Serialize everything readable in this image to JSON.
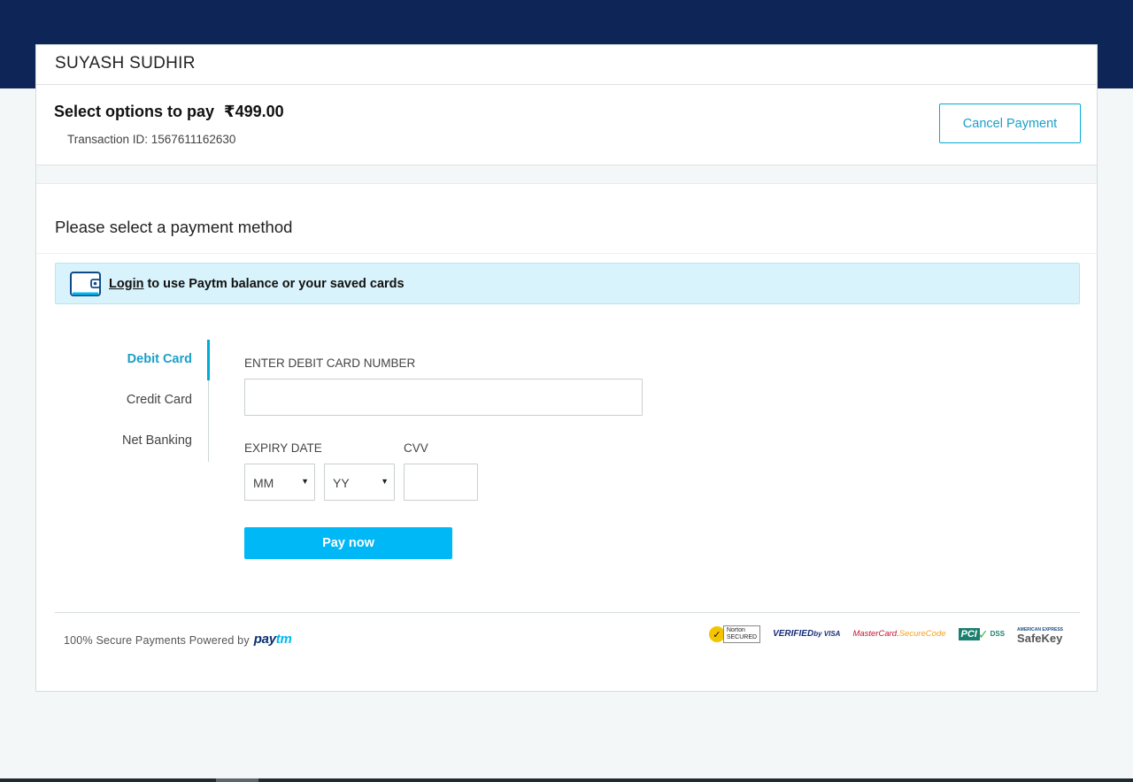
{
  "merchant": {
    "name": "SUYASH SUDHIR"
  },
  "header": {
    "title": "Select options to pay",
    "currency_symbol": "₹",
    "amount": "499.00",
    "transaction_label": "Transaction ID: 1567611162630",
    "cancel_label": "Cancel Payment"
  },
  "method_section": {
    "title": "Please select a payment method"
  },
  "login_banner": {
    "icon": "wallet-icon",
    "link_label": "Login",
    "text": "to use Paytm balance or your saved cards"
  },
  "tabs": [
    {
      "label": "Debit Card",
      "active": true
    },
    {
      "label": "Credit Card",
      "active": false
    },
    {
      "label": "Net Banking",
      "active": false
    }
  ],
  "form": {
    "card_number_label": "ENTER DEBIT CARD NUMBER",
    "card_number_value": "",
    "expiry_label": "EXPIRY DATE",
    "month_value": "MM",
    "year_value": "YY",
    "cvv_label": "CVV",
    "cvv_value": "",
    "pay_label": "Pay now"
  },
  "footer": {
    "secure_text": "100% Secure Payments Powered by",
    "paytm_logo_a": "pay",
    "paytm_logo_b": "tm",
    "badges": {
      "norton_line1": "Norton",
      "norton_line2": "SECURED",
      "visa_line1": "VERIFIED",
      "visa_line2": "by VISA",
      "mastercard_line1": "MasterCard.",
      "mastercard_line2": "SecureCode",
      "pci_label": "PCI",
      "dss_label": "DSS",
      "safekey_top": "AMERICAN EXPRESS",
      "safekey_main": "SafeKey"
    }
  },
  "colors": {
    "top_band": "#0e2557",
    "accent": "#00acd6",
    "pay_button": "#00b8f5",
    "banner_bg": "#d8f3fb"
  }
}
